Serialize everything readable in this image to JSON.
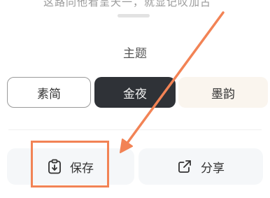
{
  "background_text": "这路同他看呈天一，就显记叹加古",
  "sheet": {
    "title": "主题",
    "themes": [
      {
        "label": "素简",
        "state": "outlined"
      },
      {
        "label": "金夜",
        "state": "selected"
      },
      {
        "label": "墨韵",
        "state": "default"
      }
    ],
    "actions": {
      "save_label": "保存",
      "save_icon": "clipboard-download-icon",
      "share_label": "分享",
      "share_icon": "share-external-icon"
    }
  },
  "annotation": {
    "color": "#f28355"
  }
}
